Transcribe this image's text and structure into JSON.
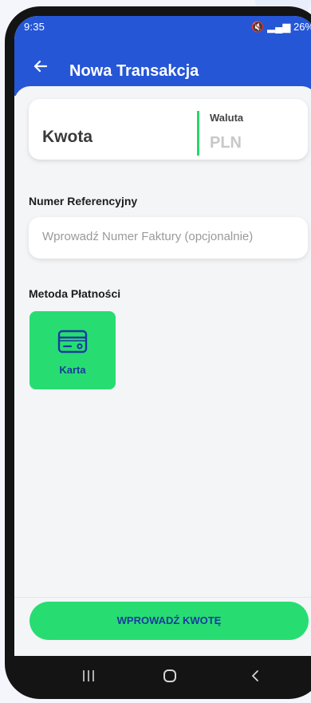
{
  "status_bar": {
    "time": "9:35",
    "battery": "26%"
  },
  "app_bar": {
    "title": "Nowa Transakcja",
    "back_icon": "arrow-left-icon"
  },
  "amount": {
    "label": "Kwota",
    "currency_label": "Waluta",
    "currency_value": "PLN"
  },
  "reference": {
    "label": "Numer Referencyjny",
    "placeholder": "Wprowadź Numer Faktury (opcjonalnie)"
  },
  "payment": {
    "label": "Metoda Płatności",
    "methods": [
      {
        "label": "Karta",
        "icon": "credit-card-icon"
      }
    ]
  },
  "submit": {
    "label": "WPROWADŹ KWOTĘ"
  },
  "colors": {
    "primary": "#2556d6",
    "accent": "#27dd72",
    "accent_text": "#1a3aa0"
  }
}
